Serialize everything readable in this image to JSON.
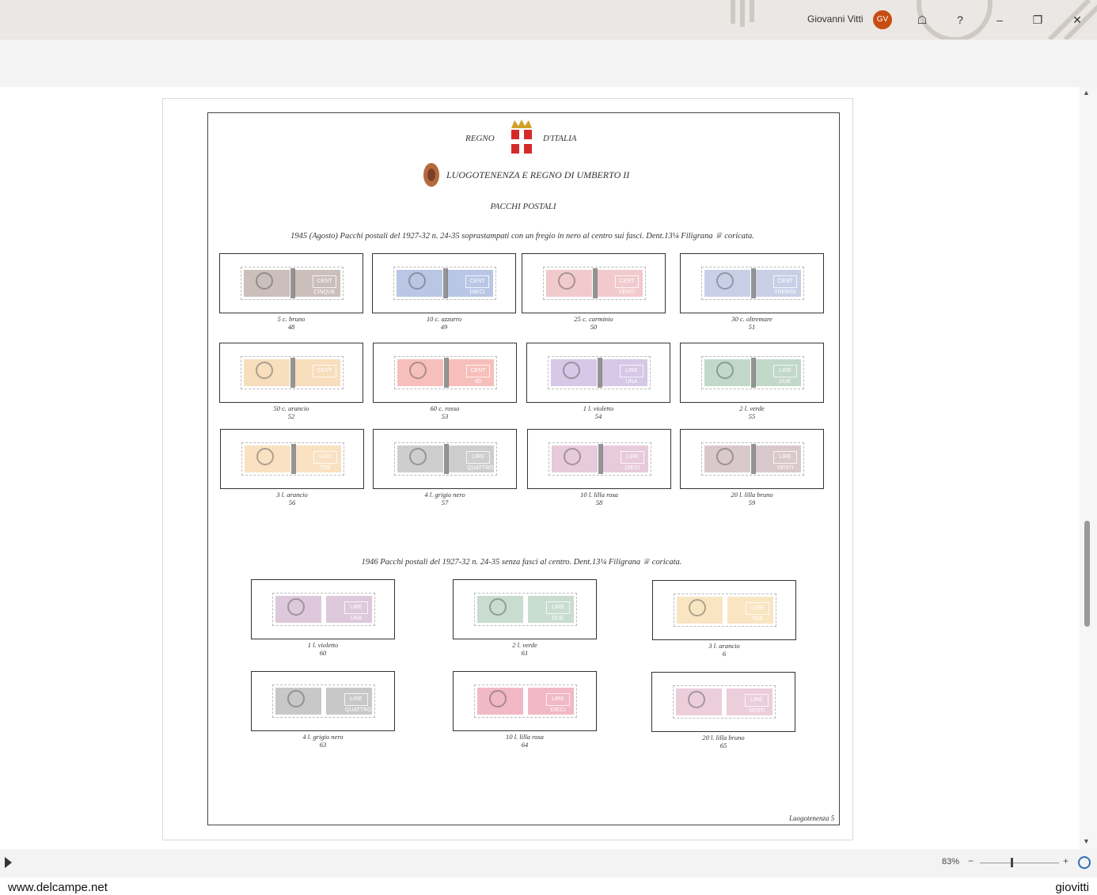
{
  "titlebar": {
    "user_name": "Giovanni Vitti",
    "avatar_initials": "GV",
    "avatar_color": "#c84d12"
  },
  "page": {
    "header_left": "REGNO",
    "header_right": "D'ITALIA",
    "subtitle": "LUOGOTENENZA E REGNO DI UMBERTO II",
    "section": "PACCHI POSTALI",
    "desc_1945": "1945 (Agosto) Pacchi postali del 1927-32 n. 24-35 soprastampati con un fregio in nero al centro sui fasci.  Dent.13¼ Filigrana ♕ coricata.",
    "desc_1946": "1946 Pacchi postali del 1927-32 n. 24-35 senza fasci al centro.  Dent.13¼ Filigrana ♕ coricata.",
    "page_footer": "Luogotenenza 5",
    "stamps_1945": [
      {
        "caption": "5 c. bruno",
        "number": "48",
        "color": "#a08a84",
        "value": "CENT CINQUE"
      },
      {
        "caption": "10 c. azzurro",
        "number": "49",
        "color": "#7f97cf",
        "value": "CENT DIECI"
      },
      {
        "caption": "25 c. carminio",
        "number": "50",
        "color": "#e59ea5",
        "value": "CENT VENTI"
      },
      {
        "caption": "30 c. oltremare",
        "number": "51",
        "color": "#9fa7d6",
        "value": "CENT TRENTA"
      },
      {
        "caption": "50 c. arancio",
        "number": "52",
        "color": "#f1c286",
        "value": "CENT"
      },
      {
        "caption": "60 c. rosso",
        "number": "53",
        "color": "#f08b84",
        "value": "CENT 60"
      },
      {
        "caption": "1 l. violetto",
        "number": "54",
        "color": "#b59bd1",
        "value": "LIRE UNA"
      },
      {
        "caption": "2 l. verde",
        "number": "55",
        "color": "#8fb89a",
        "value": "LIRE DUE"
      },
      {
        "caption": "3 l. arancio",
        "number": "56",
        "color": "#f4c88f",
        "value": "LIRE TRE"
      },
      {
        "caption": "4 l. grigio nero",
        "number": "57",
        "color": "#a6a6a6",
        "value": "LIRE QUATTRO"
      },
      {
        "caption": "10 l. lilla rosa",
        "number": "58",
        "color": "#d39fbd",
        "value": "LIRE DIECI"
      },
      {
        "caption": "20 l. lilla bruno",
        "number": "59",
        "color": "#b99aa2",
        "value": "LIRE VENTI"
      }
    ],
    "stamps_1946": [
      {
        "caption": "1 l. violetto",
        "number": "60",
        "color": "#c29bbd",
        "value": "LIRE UNA"
      },
      {
        "caption": "2 l. verde",
        "number": "61",
        "color": "#9cbfa9",
        "value": "LIRE DUE"
      },
      {
        "caption": "3 l. arancio",
        "number": "6",
        "color": "#f6d08f",
        "value": "LIRE TRE"
      },
      {
        "caption": "4 l. grigio nero",
        "number": "63",
        "color": "#9a9a9a",
        "value": "LIRE QUATTRO"
      },
      {
        "caption": "10 l. lilla rosa",
        "number": "64",
        "color": "#e57d95",
        "value": "LIRE DIECI"
      },
      {
        "caption": "20 l. lilla bruno",
        "number": "65",
        "color": "#dca5bd",
        "value": "LIRE VENTI"
      }
    ]
  },
  "statusbar": {
    "zoom": "83%",
    "zoom_minus": "−",
    "zoom_plus": "+"
  },
  "footer": {
    "left": "www.delcampe.net",
    "right": "giovitti"
  }
}
